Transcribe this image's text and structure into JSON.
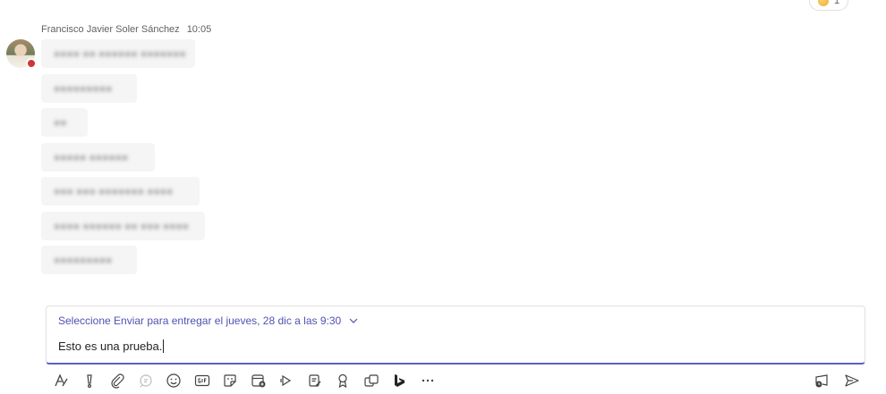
{
  "reaction": {
    "count": "1"
  },
  "message": {
    "author": "Francisco Javier Soler Sánchez",
    "time": "10:05",
    "bubbles": [
      {
        "text": "●●●● ●● ●●●●●● ●●●●●●●"
      },
      {
        "text": "●●●●●●●●●"
      },
      {
        "text": "●●"
      },
      {
        "text": "●●●●● ●●●●●●"
      },
      {
        "text": "●●● ●●● ●●●●●●● ●●●●"
      },
      {
        "text": "●●●● ●●●●●● ●● ●●● ●●●●"
      },
      {
        "text": "●●●●●●●●●"
      }
    ]
  },
  "composer": {
    "schedule_text": "Seleccione Enviar para entregar el jueves, 28 dic a las 9:30",
    "draft": "Esto es una prueba."
  },
  "colors": {
    "accent": "#5b5fc7",
    "presence": "#d13438",
    "link": "#4f52b2"
  }
}
